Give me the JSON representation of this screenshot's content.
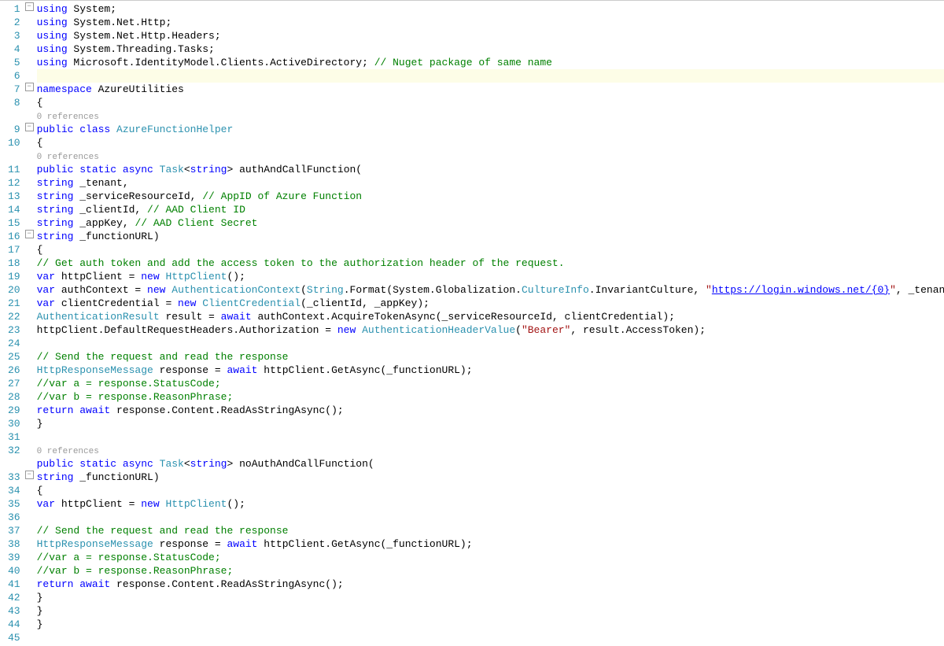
{
  "line_numbers": [
    "1",
    "2",
    "3",
    "4",
    "5",
    "6",
    "7",
    "8",
    "9",
    "10",
    "11",
    "12",
    "13",
    "14",
    "15",
    "16",
    "17",
    "18",
    "19",
    "20",
    "21",
    "22",
    "23",
    "24",
    "25",
    "26",
    "27",
    "28",
    "29",
    "30",
    "31",
    "32",
    "33",
    "34",
    "35",
    "36",
    "37",
    "38",
    "39",
    "40",
    "41",
    "42",
    "43",
    "44",
    "45"
  ],
  "codelens_text": "0 references",
  "fold_minus": "−",
  "code": {
    "l1": {
      "kw": "using",
      "rest": " System;"
    },
    "l2": {
      "kw": "using",
      "rest": " System.Net.Http;"
    },
    "l3": {
      "kw": "using",
      "rest": " System.Net.Http.Headers;"
    },
    "l4": {
      "kw": "using",
      "rest": " System.Threading.Tasks;"
    },
    "l5": {
      "kw": "using",
      "rest": " Microsoft.IdentityModel.Clients.ActiveDirectory; ",
      "cmt": "// Nuget package of same name"
    },
    "l7": {
      "kw": "namespace",
      "rest": " AzureUtilities"
    },
    "l8": {
      "rest": "{"
    },
    "l9": {
      "pad": "    ",
      "kw": "public class ",
      "type": "AzureFunctionHelper"
    },
    "l10": {
      "rest": "    {"
    },
    "l11": {
      "pad": "        ",
      "kw": "public static async ",
      "type": "Task",
      "g": "<",
      "kw2": "string",
      "g2": "> authAndCallFunction("
    },
    "l12": {
      "pad": "            ",
      "kw": "string",
      "rest": " _tenant,"
    },
    "l13": {
      "pad": "            ",
      "kw": "string",
      "rest": " _serviceResourceId, ",
      "cmt": "// AppID of Azure Function"
    },
    "l14": {
      "pad": "            ",
      "kw": "string",
      "rest": " _clientId, ",
      "cmt": "// AAD Client ID"
    },
    "l15": {
      "pad": "            ",
      "kw": "string",
      "rest": " _appKey,   ",
      "cmt": "// AAD Client Secret"
    },
    "l16": {
      "pad": "            ",
      "kw": "string",
      "rest": " _functionURL)"
    },
    "l17": {
      "rest": "        {"
    },
    "l18": {
      "pad": "            ",
      "cmt": "// Get auth token and add the access token to the authorization header of the request."
    },
    "l19": {
      "pad": "            ",
      "kw": "var",
      "mid": " httpClient = ",
      "kw2": "new ",
      "type": "HttpClient",
      "rest": "();"
    },
    "l20": {
      "pad": "            ",
      "kw": "var",
      "mid": " authContext = ",
      "kw2": "new ",
      "type": "AuthenticationContext",
      "open": "(",
      "type2": "String",
      "mid2": ".Format(System.Globalization.",
      "type3": "CultureInfo",
      "mid3": ".InvariantCulture, ",
      "str": "\"",
      "link": "https://login.windows.net/{0}",
      "str2": "\"",
      "rest": ", _tenant));"
    },
    "l21": {
      "pad": "            ",
      "kw": "var",
      "mid": " clientCredential = ",
      "kw2": "new ",
      "type": "ClientCredential",
      "rest": "(_clientId, _appKey);"
    },
    "l22": {
      "pad": "            ",
      "type": "AuthenticationResult",
      "mid": " result = ",
      "kw": "await",
      "rest": " authContext.AcquireTokenAsync(_serviceResourceId, clientCredential);"
    },
    "l23": {
      "pad": "            ",
      "mid": "httpClient.DefaultRequestHeaders.Authorization = ",
      "kw": "new ",
      "type": "AuthenticationHeaderValue",
      "open": "(",
      "str": "\"Bearer\"",
      "rest": ", result.AccessToken);"
    },
    "l25": {
      "pad": "            ",
      "cmt": "// Send the request and read the response"
    },
    "l26": {
      "pad": "            ",
      "type": "HttpResponseMessage",
      "mid": " response = ",
      "kw": "await",
      "rest": " httpClient.GetAsync(_functionURL);"
    },
    "l27": {
      "pad": "            ",
      "cmt": "//var a = response.StatusCode;"
    },
    "l28": {
      "pad": "            ",
      "cmt": "//var b = response.ReasonPhrase;"
    },
    "l29": {
      "pad": "            ",
      "kw": "return await",
      "rest": " response.Content.ReadAsStringAsync();"
    },
    "l30": {
      "rest": "        }"
    },
    "l32": {
      "pad": "        ",
      "kw": "public static async ",
      "type": "Task",
      "g": "<",
      "kw2": "string",
      "g2": "> noAuthAndCallFunction("
    },
    "l33": {
      "pad": "            ",
      "kw": "string",
      "rest": " _functionURL)"
    },
    "l34": {
      "rest": "        {"
    },
    "l35": {
      "pad": "            ",
      "kw": "var",
      "mid": " httpClient = ",
      "kw2": "new ",
      "type": "HttpClient",
      "rest": "();"
    },
    "l37": {
      "pad": "            ",
      "cmt": "// Send the request and read the response"
    },
    "l38": {
      "pad": "            ",
      "type": "HttpResponseMessage",
      "mid": " response = ",
      "kw": "await",
      "rest": " httpClient.GetAsync(_functionURL);"
    },
    "l39": {
      "pad": "            ",
      "cmt": "//var a = response.StatusCode;"
    },
    "l40": {
      "pad": "            ",
      "cmt": "//var b = response.ReasonPhrase;"
    },
    "l41": {
      "pad": "            ",
      "kw": "return await",
      "rest": " response.Content.ReadAsStringAsync();"
    },
    "l42": {
      "rest": "        }"
    },
    "l43": {
      "rest": "    }"
    },
    "l44": {
      "rest": "}"
    }
  }
}
